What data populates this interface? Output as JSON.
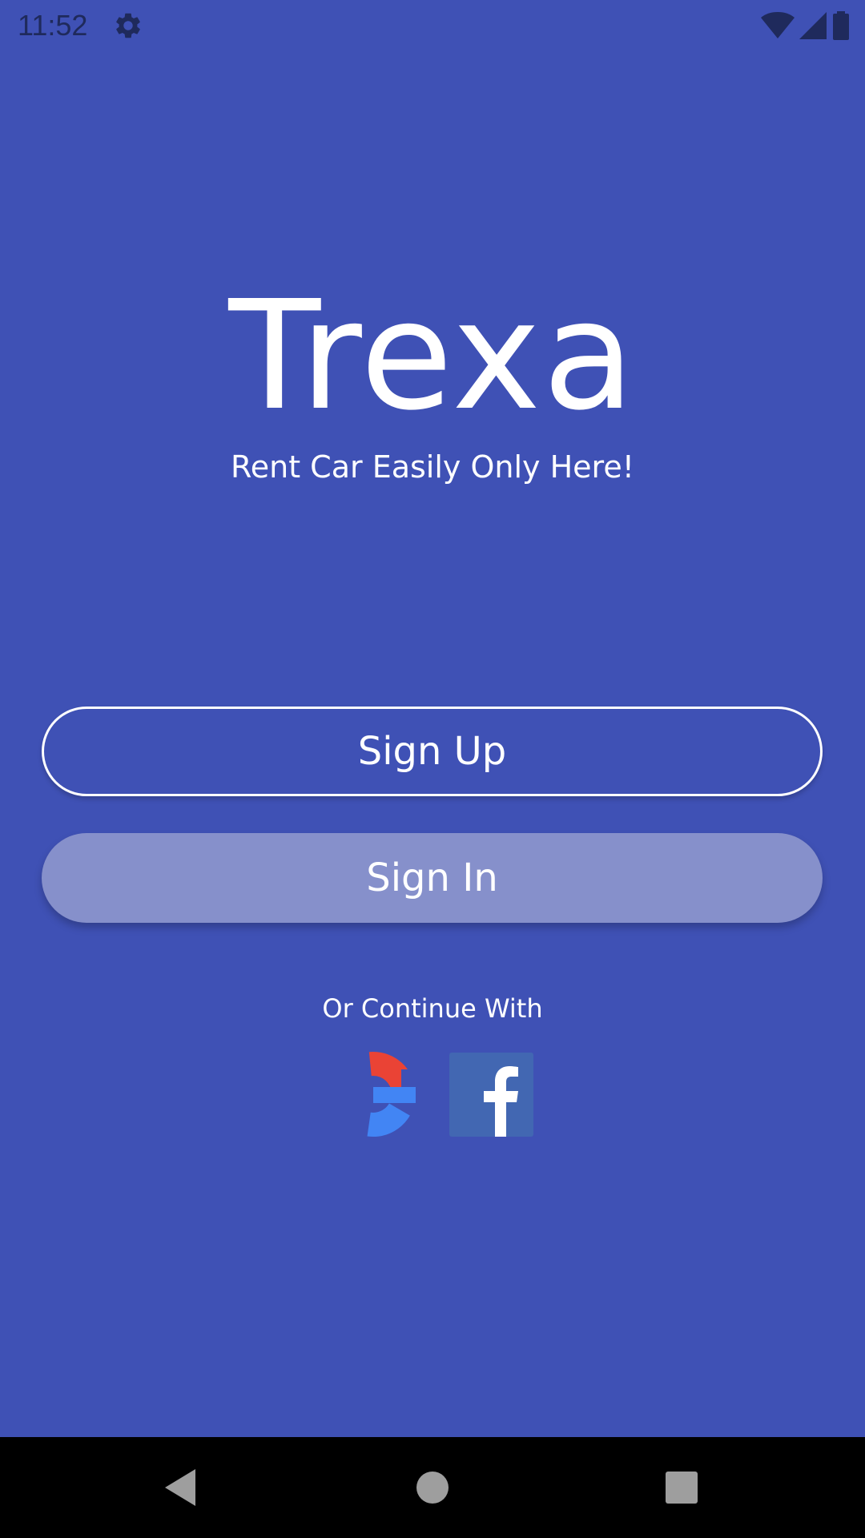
{
  "status_bar": {
    "time": "11:52",
    "icons": [
      "gear-icon",
      "wifi-icon",
      "signal-icon",
      "battery-icon"
    ]
  },
  "brand": {
    "title": "Trexa",
    "tagline": "Rent Car Easily Only Here!"
  },
  "actions": {
    "signup_label": "Sign Up",
    "signin_label": "Sign In"
  },
  "social": {
    "prompt": "Or Continue With",
    "providers": [
      "google",
      "facebook"
    ]
  },
  "nav": {
    "buttons": [
      "back",
      "home",
      "recents"
    ]
  },
  "colors": {
    "background": "#3F51B5",
    "signin_fill": "#8690CB",
    "text": "#FFFFFF",
    "facebook": "#4267B2"
  }
}
